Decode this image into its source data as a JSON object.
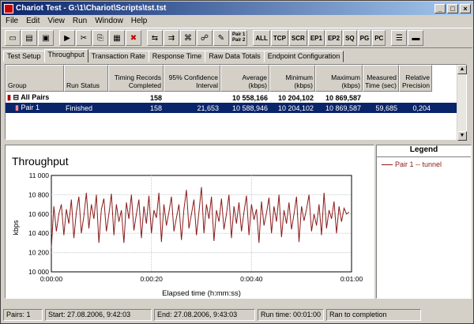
{
  "window": {
    "title": "Chariot Test - G:\\1\\Chariot\\Scripts\\tst.tst"
  },
  "menu": [
    "File",
    "Edit",
    "View",
    "Run",
    "Window",
    "Help"
  ],
  "toolbar": {
    "text_buttons": [
      "ALL",
      "TCP",
      "SCR",
      "EP1",
      "EP2",
      "SQ",
      "PG",
      "PC"
    ],
    "pair_label_1": "Pair 1",
    "pair_label_2": "Pair 2"
  },
  "tabs": [
    "Test Setup",
    "Throughput",
    "Transaction Rate",
    "Response Time",
    "Raw Data Totals",
    "Endpoint Configuration"
  ],
  "active_tab": "Throughput",
  "grid": {
    "headers": [
      "Group",
      "Run Status",
      "Timing Records Completed",
      "95% Confidence Interval",
      "Average (kbps)",
      "Minimum (kbps)",
      "Maximum (kbps)",
      "Measured Time (sec)",
      "Relative Precision"
    ],
    "rows": [
      {
        "group": "All Pairs",
        "status": "",
        "records": "158",
        "ci": "",
        "avg": "10 558,166",
        "min": "10 204,102",
        "max": "10 869,587",
        "time": "",
        "precision": ""
      },
      {
        "group": "Pair 1",
        "status": "Finished",
        "records": "158",
        "ci": "21,653",
        "avg": "10 588,946",
        "min": "10 204,102",
        "max": "10 869,587",
        "time": "59,685",
        "precision": "0,204"
      }
    ]
  },
  "legend": {
    "title": "Legend",
    "item": "Pair 1 -- tunnel"
  },
  "status": {
    "pairs": "Pairs: 1",
    "start": "Start: 27.08.2006, 9:42:03",
    "end": "End: 27.08.2006, 9:43:03",
    "runtime": "Run time: 00:01:00",
    "result": "Ran to completion"
  },
  "chart_data": {
    "type": "line",
    "title": "Throughput",
    "xlabel": "Elapsed time (h:mm:ss)",
    "ylabel": "kbps",
    "ylim": [
      10000,
      11000
    ],
    "xlim": [
      0,
      60
    ],
    "yticks": [
      "10 000",
      "10 200",
      "10 400",
      "10 600",
      "10 800",
      "11 000"
    ],
    "xticks": [
      "0:00:00",
      "0:00:20",
      "0:00:40",
      "0:01:00"
    ],
    "series": [
      {
        "name": "Pair 1 -- tunnel",
        "color": "#8b1a1a",
        "x": [
          0,
          0.5,
          1,
          1.5,
          2,
          2.5,
          3,
          3.5,
          4,
          4.5,
          5,
          5.5,
          6,
          6.5,
          7,
          7.5,
          8,
          8.5,
          9,
          9.5,
          10,
          10.5,
          11,
          11.5,
          12,
          12.5,
          13,
          13.5,
          14,
          14.5,
          15,
          15.5,
          16,
          16.5,
          17,
          17.5,
          18,
          18.5,
          19,
          19.5,
          20,
          20.5,
          21,
          21.5,
          22,
          22.5,
          23,
          23.5,
          24,
          24.5,
          25,
          25.5,
          26,
          26.5,
          27,
          27.5,
          28,
          28.5,
          29,
          29.5,
          30,
          30.5,
          31,
          31.5,
          32,
          32.5,
          33,
          33.5,
          34,
          34.5,
          35,
          35.5,
          36,
          36.5,
          37,
          37.5,
          38,
          38.5,
          39,
          39.5,
          40,
          40.5,
          41,
          41.5,
          42,
          42.5,
          43,
          43.5,
          44,
          44.5,
          45,
          45.5,
          46,
          46.5,
          47,
          47.5,
          48,
          48.5,
          49,
          49.5,
          50,
          50.5,
          51,
          51.5,
          52,
          52.5,
          53,
          53.5,
          54,
          54.5,
          55,
          55.5,
          56,
          56.5,
          57,
          57.5,
          58,
          58.5,
          59,
          59.5
        ],
        "values": [
          10250,
          10680,
          10420,
          10600,
          10700,
          10380,
          10650,
          10500,
          10750,
          10350,
          10620,
          10780,
          10400,
          10580,
          10820,
          10450,
          10700,
          10550,
          10800,
          10300,
          10650,
          10760,
          10420,
          10600,
          10810,
          10380,
          10700,
          10520,
          10640,
          10300,
          10720,
          10550,
          10800,
          10430,
          10600,
          10750,
          10350,
          10680,
          10500,
          10790,
          10400,
          10640,
          10560,
          10820,
          10310,
          10700,
          10480,
          10620,
          10780,
          10420,
          10560,
          10700,
          10330,
          10650,
          10850,
          10450,
          10600,
          10750,
          10380,
          10620,
          10880,
          10400,
          10700,
          10550,
          10780,
          10320,
          10640,
          10520,
          10760,
          10440,
          10600,
          10800,
          10350,
          10680,
          10500,
          10720,
          10420,
          10620,
          10790,
          10380,
          10700,
          10540,
          10650,
          10300,
          10730,
          10480,
          10610,
          10770,
          10400,
          10680,
          10520,
          10800,
          10360,
          10640,
          10500,
          10720,
          10440,
          10600,
          10780,
          10310,
          10680,
          10530,
          10650,
          10800,
          10420,
          10600,
          10480,
          10700,
          10380,
          10820,
          10450,
          10640,
          10550,
          10730,
          10400,
          10680,
          10520,
          10660,
          10600,
          10620
        ]
      }
    ]
  }
}
